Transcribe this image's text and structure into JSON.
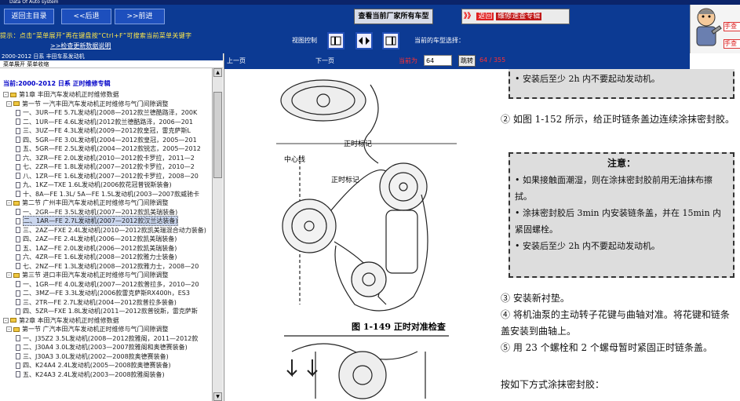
{
  "window": {
    "title": "Data Of Auto system"
  },
  "topbar": {
    "home": "返回主目录",
    "back": "<<后退",
    "forward": ">>前进",
    "vendor_btn": "查看当前厂家所有车型",
    "back_arrows": "》》",
    "back_return": "返回",
    "back_specific": "维修速查专辑",
    "mascot_text_1": "手查不",
    "mascot_text_2": "手查"
  },
  "toolrow": {
    "hint": "提示：点击“菜单展开”再在键盘按“Ctrl+F”可搜索当前菜单关键字",
    "hint_link": ">>检查更新数据说明",
    "display_label": "视图控制",
    "current_label": "当前的车型选择："
  },
  "left_panel": {
    "header": "2000-2012 日系 丰田车系发动机",
    "tools": "菜单展开   菜单收缩",
    "tree_title": "当前:2000-2012 日系 正时维修专辑",
    "tree": [
      {
        "level": 0,
        "kind": "folder",
        "text": "第1章 丰田汽车发动机正时维修数据"
      },
      {
        "level": 1,
        "kind": "folder",
        "text": "第一节 一汽丰田汽车发动机正时维修与气门间隙调整"
      },
      {
        "level": 2,
        "kind": "doc",
        "text": "一、3UR—FE 5.7L发动机(2008—2012款兰德酷路泽，200K"
      },
      {
        "level": 2,
        "kind": "doc",
        "text": "二、1UR—FE 4.6L发动机(2012款兰德酷路泽，2006—201"
      },
      {
        "level": 2,
        "kind": "doc",
        "text": "三、3UZ—FE 4.3L发动机(2009—2012款皇冠，雷克萨斯L"
      },
      {
        "level": 2,
        "kind": "doc",
        "text": "四、5GR—FE 3.0L发动机(2004—2012款皇冠，2005—201"
      },
      {
        "level": 2,
        "kind": "doc",
        "text": "五、5GR—FE 2.5L发动机(2004—2012款锐志，2005—2012"
      },
      {
        "level": 2,
        "kind": "doc",
        "text": "六、3ZR—FE 2.0L发动机(2010—2012款卡罗拉，2011—2"
      },
      {
        "level": 2,
        "kind": "doc",
        "text": "七、2ZR—FE 1.8L发动机(2007—2012款卡罗拉，2010—2"
      },
      {
        "level": 2,
        "kind": "doc",
        "text": "八、1ZR—FE 1.6L发动机(2007—2012款卡罗拉，2008—20"
      },
      {
        "level": 2,
        "kind": "doc",
        "text": "九、1KZ—TXE 1.6L发动机(2006款花冠普锐斯装备)"
      },
      {
        "level": 2,
        "kind": "doc",
        "text": "十、8A—FE 1.3L/ 5A—FE 1.5L发动机(2003—2007款威驰卡"
      },
      {
        "level": 1,
        "kind": "folder",
        "text": "第二节 广州丰田汽车发动机正时维修与气门间隙调整"
      },
      {
        "level": 2,
        "kind": "doc",
        "text": "一、2GR—FE 3.5L发动机(2007—2012款凯美瑞装备)"
      },
      {
        "level": 2,
        "kind": "doc",
        "text": "二、1AR—FE 2.7L发动机(2007—2012款汉兰达装备)",
        "selected": true
      },
      {
        "level": 2,
        "kind": "doc",
        "text": "三、2AZ—FXE 2.4L发动机(2010—2012款凯美瑞混合动力装备)"
      },
      {
        "level": 2,
        "kind": "doc",
        "text": "四、2AZ—FE 2.4L发动机(2006—2012款凯美瑞装备)"
      },
      {
        "level": 2,
        "kind": "doc",
        "text": "五、1AZ—FE 2.0L发动机(2006—2012款凯美瑞装备)"
      },
      {
        "level": 2,
        "kind": "doc",
        "text": "六、4ZR—FE 1.6L发动机(2008—2012款雅力士装备)"
      },
      {
        "level": 2,
        "kind": "doc",
        "text": "七、2NZ—FE 1.3L发动机(2008—2012款雅力士，2008—20"
      },
      {
        "level": 1,
        "kind": "folder",
        "text": "第三节 进口丰田汽车发动机正时维修与气门间隙调整"
      },
      {
        "level": 2,
        "kind": "doc",
        "text": "一、1GR—FE 4.0L发动机(2007—2012款普拉多，2010—20"
      },
      {
        "level": 2,
        "kind": "doc",
        "text": "二、3MZ—FE 3.3L发动机(2006款雷克萨斯RX400h，ES3"
      },
      {
        "level": 2,
        "kind": "doc",
        "text": "三、2TR—FE 2.7L发动机(2004—2012款普拉多装备)"
      },
      {
        "level": 2,
        "kind": "doc",
        "text": "四、5ZR—FXE 1.8L发动机(2011—2012款普锐斯，雷克萨斯"
      },
      {
        "level": 0,
        "kind": "folder",
        "text": "第2章 本田汽车发动机正时维修数据"
      },
      {
        "level": 1,
        "kind": "folder",
        "text": "第一节 广汽本田汽车发动机正时维修与气门间隙调整"
      },
      {
        "level": 2,
        "kind": "doc",
        "text": "一、J35Z2 3.5L发动机(2008—2012款雅阁，2011—2012款"
      },
      {
        "level": 2,
        "kind": "doc",
        "text": "二、J30A4 3.0L发动机(2003—2007款雅阁和奥德赛装备)"
      },
      {
        "level": 2,
        "kind": "doc",
        "text": "三、J30A3 3.0L发动机(2002—2008款奥德赛装备)"
      },
      {
        "level": 2,
        "kind": "doc",
        "text": "四、K24A4 2.4L发动机(2005—2008款奥德赛装备)"
      },
      {
        "level": 2,
        "kind": "doc",
        "text": "五、K24A3 2.4L发动机(2003—2008款雅阁装备)"
      }
    ]
  },
  "pagebar": {
    "prev": "上一页",
    "next": "下一页",
    "current_label": "当前为",
    "page_value": "64",
    "go": "跳转",
    "count": "64 / 355"
  },
  "document": {
    "top_note": "• 安装后至少 2h 内不要起动发动机。",
    "para1": "② 如图 1-152 所示，给正时链条盖边连续涂抹密封胶。",
    "note_title": "注意：",
    "note_1": "• 如果接触面潮湿，则在涂抹密封胶前用无油抹布擦拭。",
    "note_2": "• 涂抹密封胶后 3min 内安装链条盖，并在 15min 内紧固螺栓。",
    "note_3": "• 安装后至少 2h 内不要起动发动机。",
    "para2": "③ 安装新衬垫。",
    "para3": "④ 将机油泵的主动转子花键与曲轴对准。将花键和链条盖安装到曲轴上。",
    "para4": "⑤ 用 23 个螺栓和 2 个螺母暂时紧固正时链条盖。",
    "para5": "按如下方式涂抹密封胶：",
    "fig_label_1": "正时标记",
    "fig_label_2": "中心线",
    "fig_label_3": "正时标记",
    "fig_caption": "图 1-149  正时对准检查"
  }
}
